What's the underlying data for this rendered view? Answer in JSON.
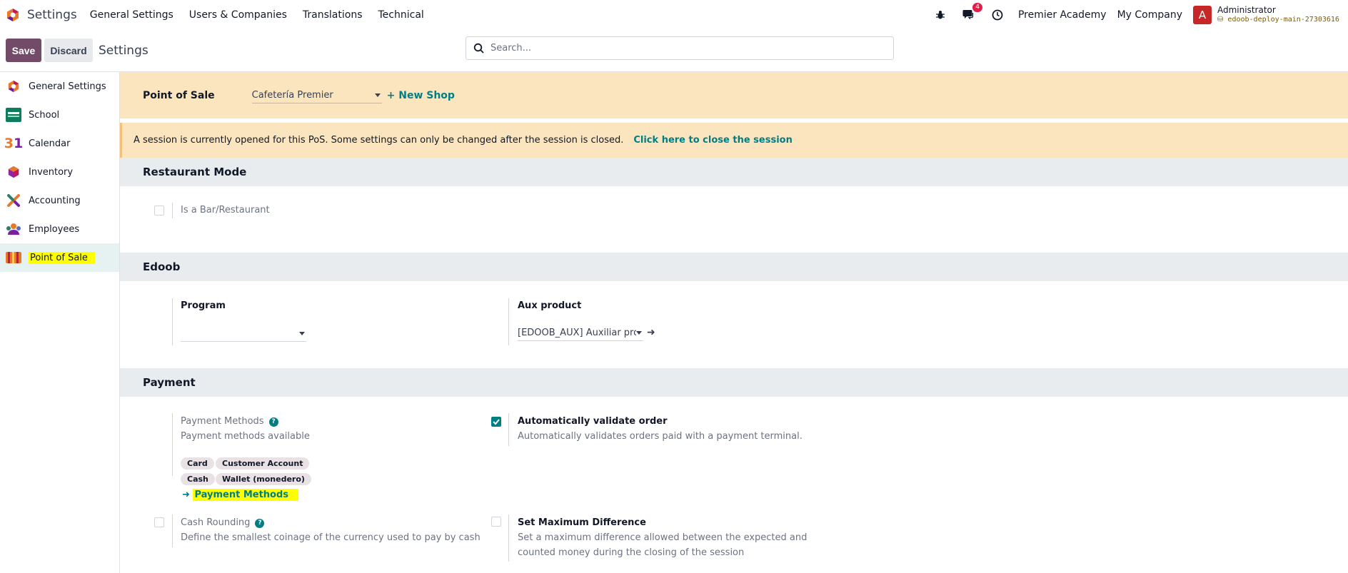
{
  "navbar": {
    "app_title": "Settings",
    "menu": [
      "General Settings",
      "Users & Companies",
      "Translations",
      "Technical"
    ],
    "messages_count": "4",
    "company": "Premier Academy",
    "my_company": "My Company",
    "avatar_letter": "A",
    "user_name": "Administrator",
    "database": "edoob-deploy-main-27303616"
  },
  "control": {
    "save_label": "Save",
    "discard_label": "Discard",
    "title": "Settings",
    "search_placeholder": "Search..."
  },
  "sidebar": {
    "items": [
      {
        "label": "General Settings",
        "icon": "settings-logo-icon"
      },
      {
        "label": "School",
        "icon": "school-icon"
      },
      {
        "label": "Calendar",
        "icon": "calendar-icon"
      },
      {
        "label": "Inventory",
        "icon": "inventory-icon"
      },
      {
        "label": "Accounting",
        "icon": "accounting-icon"
      },
      {
        "label": "Employees",
        "icon": "employees-icon"
      },
      {
        "label": "Point of Sale",
        "icon": "point-of-sale-icon"
      }
    ],
    "active_index": 6
  },
  "pos_bar": {
    "label": "Point of Sale",
    "shop": "Cafetería Premier",
    "new_shop": "+ New Shop"
  },
  "alert": {
    "text": "A session is currently opened for this PoS. Some settings can only be changed after the session is closed.",
    "link": "Click here to close the session"
  },
  "restaurant": {
    "title": "Restaurant Mode",
    "is_bar_label": "Is a Bar/Restaurant",
    "is_bar_checked": false
  },
  "edoob": {
    "title": "Edoob",
    "program_label": "Program",
    "program_value": "",
    "aux_label": "Aux product",
    "aux_value": "[EDOOB_AUX] Auxiliar pro"
  },
  "payment": {
    "title": "Payment",
    "methods_label": "Payment Methods",
    "methods_desc": "Payment methods available",
    "tags": [
      "Card",
      "Customer Account",
      "Cash",
      "Wallet (monedero)"
    ],
    "methods_link": "Payment Methods",
    "auto_validate_label": "Automatically validate order",
    "auto_validate_desc": "Automatically validates orders paid with a payment terminal.",
    "auto_validate_checked": true,
    "cash_rounding_label": "Cash Rounding",
    "cash_rounding_desc": "Define the smallest coinage of the currency used to pay by cash",
    "cash_rounding_checked": false,
    "max_diff_label": "Set Maximum Difference",
    "max_diff_desc_1": "Set a maximum difference allowed between the expected and",
    "max_diff_desc_2": "counted money during the closing of the session",
    "max_diff_checked": false
  },
  "colors": {
    "brand": "#714b67",
    "accent": "#017e84",
    "warning_bg": "#fbe5bf",
    "highlight": "#ffff00"
  }
}
